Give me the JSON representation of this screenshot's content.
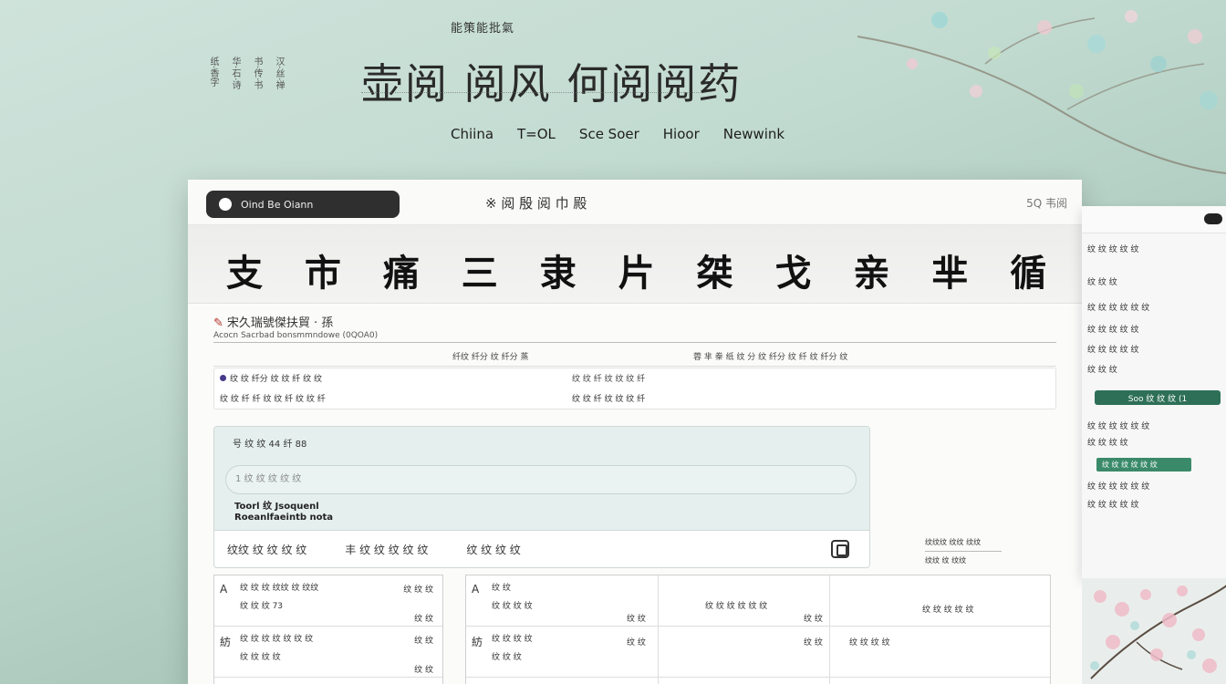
{
  "hero": {
    "eyebrow": "能策能批氣",
    "vertical_deco": [
      "纸·香字",
      "华·石·诗",
      "书·传·书",
      "汉·丝·禅"
    ],
    "title": "壶阅 阅风 何阅阅药",
    "nav": [
      "Chiina",
      "T=OL",
      "Sce Soer",
      "Hioor",
      "Newwink"
    ]
  },
  "window": {
    "pill_label": "Oind Be Oiann",
    "title": "※ 阅 殷 阅 巾 殿",
    "right_meta": "5Q 韦阅",
    "banner": "支 市 痛 三 隶 片 桀 戈 亲 芈 循"
  },
  "section": {
    "heading_mark": "✎",
    "heading": "宋久瑞號傑扶貿 · 孫",
    "meta": "Acocn Sacrbad bonsmmndowe (0QOA0)",
    "column_heads": [
      "纤纹 纤分 纹 纤分 蒸",
      "蓉 芈 桊 纸 纹 分 纹 纤分 纹 纤 纹 纤分 纹"
    ],
    "info_lines": [
      "纹 纹 纤分 纹 纹 纤 纹 纹",
      "纹 纹 纤 纤 纹 纹 纤 纹 纹 纤"
    ],
    "info_center": [
      "纹 纹  纤 纹 纹 纹 纤",
      "纹 纹 纤 纹 纹 纹 纤"
    ]
  },
  "form": {
    "label": "号 纹 纹 44 纤 88",
    "input_placeholder": "1 纹 纹 纹 纹 纹",
    "line1": "Toorl 纹 Jsoquenl",
    "line2": "Roeanlfaeintb nota",
    "row_items": [
      "纹纹 纹 纹 纹 纹",
      "丰 纹 纹 纹 纹 纹",
      "纹 纹 纹 纹"
    ]
  },
  "side_meta": [
    "纹纹纹 纹纹 纹纹",
    "纹纹 纹 纹纹"
  ],
  "tables": {
    "left": [
      {
        "lead": "A",
        "text": "纹 纹 纹 纹纹 纹 纹纹",
        "text2": "纹 纹 纹 73",
        "right": "纹 纹 纹",
        "right2": "纹 纹"
      },
      {
        "lead": "紡",
        "text": "纹 纹 纹 纹 纹 纹 纹",
        "text2": "纹 纹 纹 纹",
        "right": "纹 纹",
        "right2": "纹 纹"
      }
    ],
    "middle": [
      {
        "lead": "A",
        "text": "纹 纹",
        "text2": "纹 纹 纹 纹",
        "right": "纹 纹",
        "center": "纹 纹 纹 纹 纹 纹",
        "right3": "纹 纹",
        "far": "纹 纹 纹 纹 纹"
      },
      {
        "lead": "紡",
        "text": "纹 纹 纹 纹",
        "text2": "纹 纹 纹",
        "right": "纹 纹",
        "center": "",
        "right3": "纹 纹",
        "far": "纹 纹 纹 纹"
      }
    ]
  },
  "side_panel": {
    "lines": [
      "纹 纹 纹 纹 纹",
      "纹 纹 纹",
      "纹 纹 纹 纹 纹 纹",
      "纹 纹 纹 纹 纹",
      "纹 纹 纹 纹 纹",
      "纹 纹 纹"
    ],
    "button1": "Soo 纹 纹 纹 (1",
    "lines2": [
      "纹 纹 纹 纹 纹 纹",
      "纹 纹 纹 纹"
    ],
    "button2": "纹 纹 纹 纹 纹 纹",
    "lines3": [
      "纹 纹 纹 纹 纹 纹",
      "纹 纹 纹 纹 纹"
    ]
  },
  "colors": {
    "accent_green": "#2e6f58",
    "banner_text": "#111111",
    "heading_red": "#b0302a"
  }
}
